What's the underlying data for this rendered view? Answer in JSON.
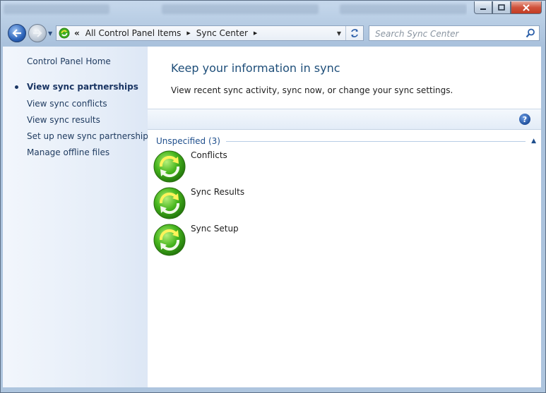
{
  "window": {
    "caption_minimize": "–",
    "caption_maximize": "□",
    "caption_close": "✕"
  },
  "address_bar": {
    "overflow_chevron": "«",
    "crumbs": [
      "All Control Panel Items",
      "Sync Center"
    ]
  },
  "search": {
    "placeholder": "Search Sync Center"
  },
  "sidebar": {
    "home": "Control Panel Home",
    "items": [
      {
        "label": "View sync partnerships",
        "active": true
      },
      {
        "label": "View sync conflicts"
      },
      {
        "label": "View sync results"
      },
      {
        "label": "Set up new sync partnerships"
      },
      {
        "label": "Manage offline files"
      }
    ]
  },
  "main": {
    "title": "Keep your information in sync",
    "description": "View recent sync activity, sync now, or change your sync settings.",
    "help": "?",
    "group": {
      "label": "Unspecified (3)",
      "toggle": "▲",
      "items": [
        {
          "label": "Conflicts",
          "icon": "sync-icon"
        },
        {
          "label": "Sync Results",
          "icon": "sync-icon"
        },
        {
          "label": "Sync Setup",
          "icon": "sync-icon"
        }
      ]
    }
  },
  "colors": {
    "accent_title": "#1e4e79",
    "sync_green": "#3fae1f",
    "sync_arrow_yellow": "#f4e23a"
  }
}
